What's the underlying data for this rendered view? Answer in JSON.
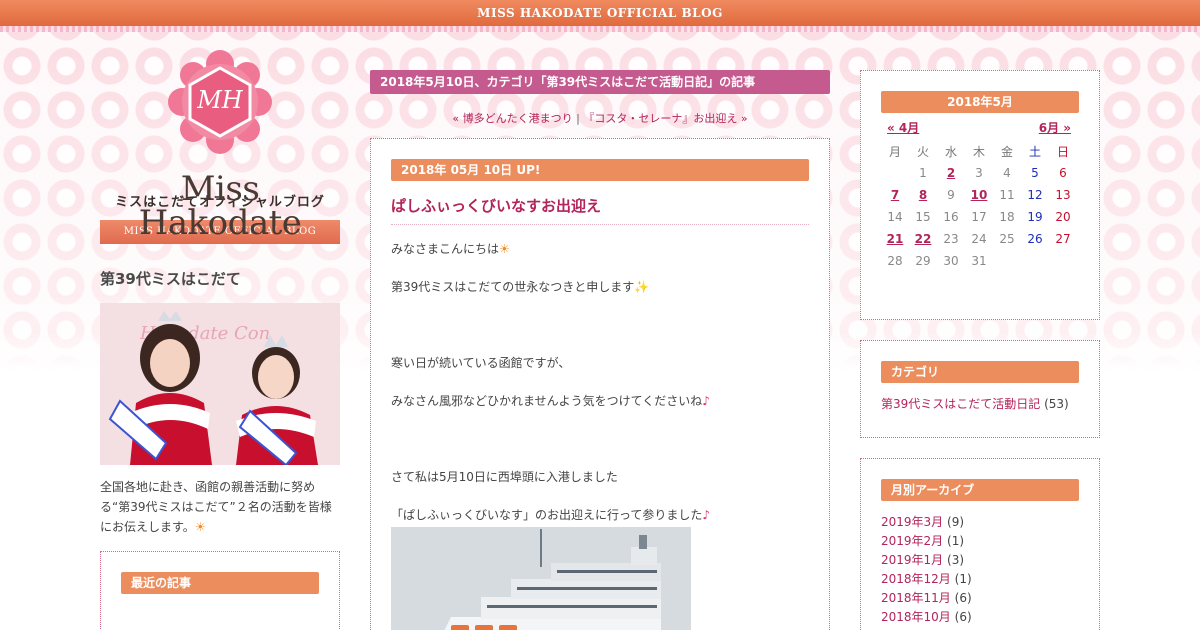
{
  "header": {
    "site_title": "MISS HAKODATE OFFICIAL BLOG"
  },
  "sidebar_left": {
    "logo_letters": "MH",
    "brand_name": "Miss Hakodate",
    "brand_subtitle": "ミスはこだてオフィシャルブログ",
    "brand_ribbon": "MISS HAKODATE OFFICIAL BLOG",
    "section_title": "第39代ミスはこだて",
    "photo_banner_text": "Hakodate Con",
    "description": "全国各地に赴き、函館の親善活動に努める“第39代ミスはこだて”２名の活動を皆様にお伝えします。",
    "recent_posts_title": "最近の記事"
  },
  "main": {
    "category_header": "2018年5月10日、カテゴリ「第39代ミスはこだて活動日記」の記事",
    "pager": {
      "prev_label": "« 博多どんたく港まつり",
      "separator": "|",
      "next_label": "『コスタ・セレーナ』お出迎え »"
    },
    "post": {
      "date": "2018年 05月 10日 UP!",
      "title": "ぱしふぃっくびいなすお出迎え",
      "paragraphs": [
        "みなさまこんにちは",
        "第39代ミスはこだての世永なつきと申します",
        "",
        "寒い日が続いている函館ですが、",
        "みなさん風邪などひかれませんよう気をつけてくださいね",
        "",
        "さて私は5月10日に西埠頭に入港しました",
        "「ぱしふぃっくびいなす」のお出迎えに行って参りました"
      ]
    }
  },
  "sidebar_right": {
    "calendar": {
      "title": "2018年5月",
      "prev": "« 4月",
      "next": "6月 »",
      "weekdays": [
        "月",
        "火",
        "水",
        "木",
        "金",
        "土",
        "日"
      ],
      "weeks": [
        [
          "",
          "1",
          "2",
          "3",
          "4",
          "5",
          "6"
        ],
        [
          "7",
          "8",
          "9",
          "10",
          "11",
          "12",
          "13"
        ],
        [
          "14",
          "15",
          "16",
          "17",
          "18",
          "19",
          "20"
        ],
        [
          "21",
          "22",
          "23",
          "24",
          "25",
          "26",
          "27"
        ],
        [
          "28",
          "29",
          "30",
          "31",
          "",
          "",
          ""
        ]
      ],
      "linked_days": [
        "2",
        "7",
        "8",
        "10",
        "21",
        "22"
      ]
    },
    "categories": {
      "title": "カテゴリ",
      "items": [
        {
          "label": "第39代ミスはこだて活動日記",
          "count": "(53)"
        }
      ]
    },
    "archives": {
      "title": "月別アーカイブ",
      "items": [
        {
          "label": "2019年3月",
          "count": "(9)"
        },
        {
          "label": "2019年2月",
          "count": "(1)"
        },
        {
          "label": "2019年1月",
          "count": "(3)"
        },
        {
          "label": "2018年12月",
          "count": "(1)"
        },
        {
          "label": "2018年11月",
          "count": "(6)"
        },
        {
          "label": "2018年10月",
          "count": "(6)"
        }
      ]
    }
  },
  "colors": {
    "accent_orange": "#ec8d5e",
    "link_crimson": "#b3245a",
    "category_bar": "#c55a8f"
  }
}
